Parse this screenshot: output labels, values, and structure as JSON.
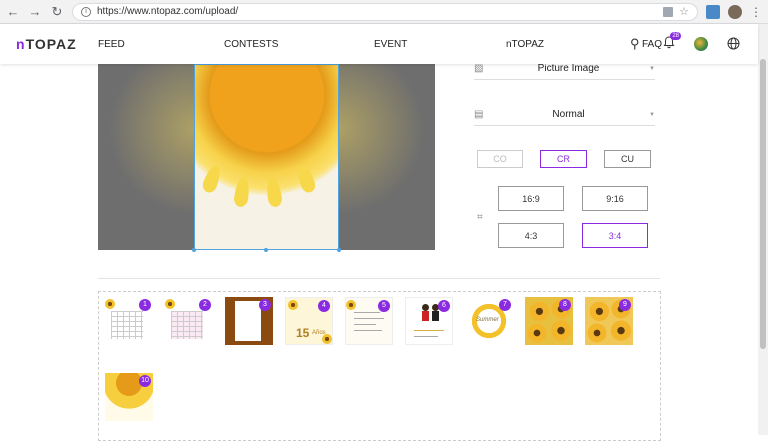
{
  "browser": {
    "url": "https://www.ntopaz.com/upload/",
    "info_icon": "i",
    "back_icon": "←",
    "forward_icon": "→",
    "reload_icon": "↻",
    "star_icon": "☆",
    "menu_icon": "⋮"
  },
  "header": {
    "logo_n": "n",
    "logo_rest": "TOPAZ",
    "nav": [
      "FEED",
      "CONTESTS",
      "EVENT",
      "nTOPAZ"
    ],
    "faq": "FAQ",
    "notification_count": "28",
    "search_icon": "⚲",
    "bell_icon": "🔔",
    "globe_icon": "⊕"
  },
  "controls": {
    "layout_type": "Picture Image",
    "filter": "Normal",
    "crop_modes": [
      "CO",
      "CR",
      "CU"
    ],
    "active_crop_mode": "CR",
    "ratios": [
      "16:9",
      "9:16",
      "4:3",
      "3:4"
    ],
    "active_ratio": "3:4",
    "caret": "▼"
  },
  "gallery": {
    "numbers": [
      "1",
      "2",
      "3",
      "4",
      "5",
      "6",
      "7",
      "8",
      "9",
      "10"
    ],
    "thumb_texts": {
      "t3": "🌻",
      "t4": "15",
      "t4_sub": "Años",
      "t7": "Summer"
    }
  },
  "colors": {
    "accent": "#8a2be2",
    "selection": "#4fa3e0",
    "canvas_bg": "#6e6e6e"
  }
}
